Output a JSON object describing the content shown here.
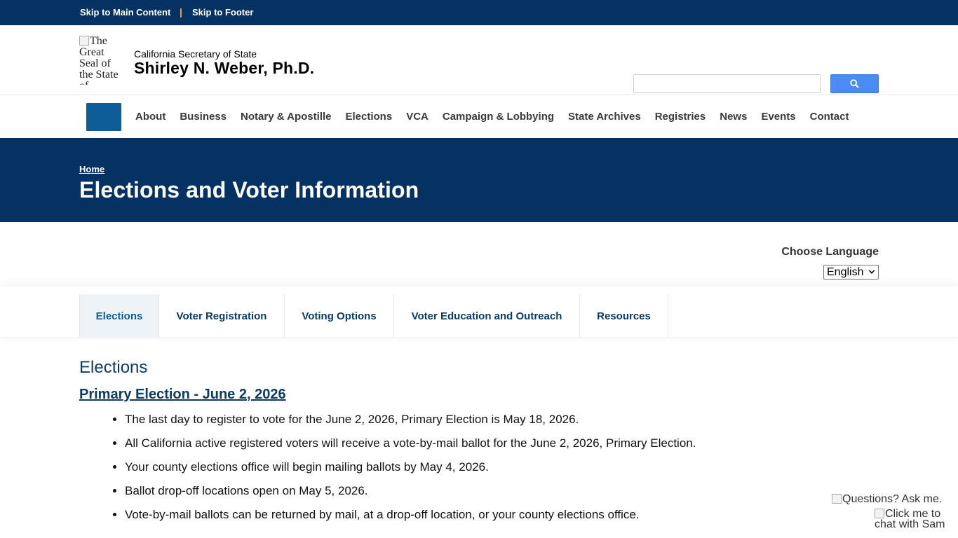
{
  "skip_links": {
    "main": "Skip to Main Content",
    "separator": "|",
    "footer": "Skip to Footer"
  },
  "header": {
    "seal_alt": "The Great Seal of the State of",
    "org_name": "California Secretary of State",
    "person_name": "Shirley N. Weber, Ph.D.",
    "search_placeholder": ""
  },
  "nav": {
    "items": [
      "About",
      "Business",
      "Notary & Apostille",
      "Elections",
      "VCA",
      "Campaign & Lobbying",
      "State Archives",
      "Registries",
      "News",
      "Events",
      "Contact"
    ]
  },
  "banner": {
    "breadcrumb": "Home",
    "title": "Elections and Voter Information"
  },
  "language": {
    "label": "Choose Language",
    "selected": "English"
  },
  "subtabs": [
    {
      "label": "Elections",
      "active": true
    },
    {
      "label": "Voter Registration",
      "active": false
    },
    {
      "label": "Voting Options",
      "active": false
    },
    {
      "label": "Voter Education and Outreach",
      "active": false
    },
    {
      "label": "Resources",
      "active": false
    }
  ],
  "content": {
    "section_heading": "Elections",
    "primary_link": "Primary Election - June 2, 2026",
    "bullets": [
      "The last day to register to vote for the June 2, 2026, Primary Election is May 18, 2026.",
      "All California active registered voters will receive a vote-by-mail ballot for the June 2, 2026, Primary Election.",
      "Your county elections office will begin mailing ballots by May 4, 2026.",
      "Ballot drop-off locations open on May 5, 2026.",
      "Vote-by-mail ballots can be returned by mail, at a drop-off location, or your county elections office."
    ]
  },
  "chat": {
    "question_alt": "Questions? Ask me.",
    "click_alt": "Click me to chat with Sam"
  },
  "colors": {
    "brand_navy": "#063263",
    "accent_blue": "#0e5d98",
    "search_blue": "#4c8bf5",
    "skip_separator": "#f2b318"
  }
}
